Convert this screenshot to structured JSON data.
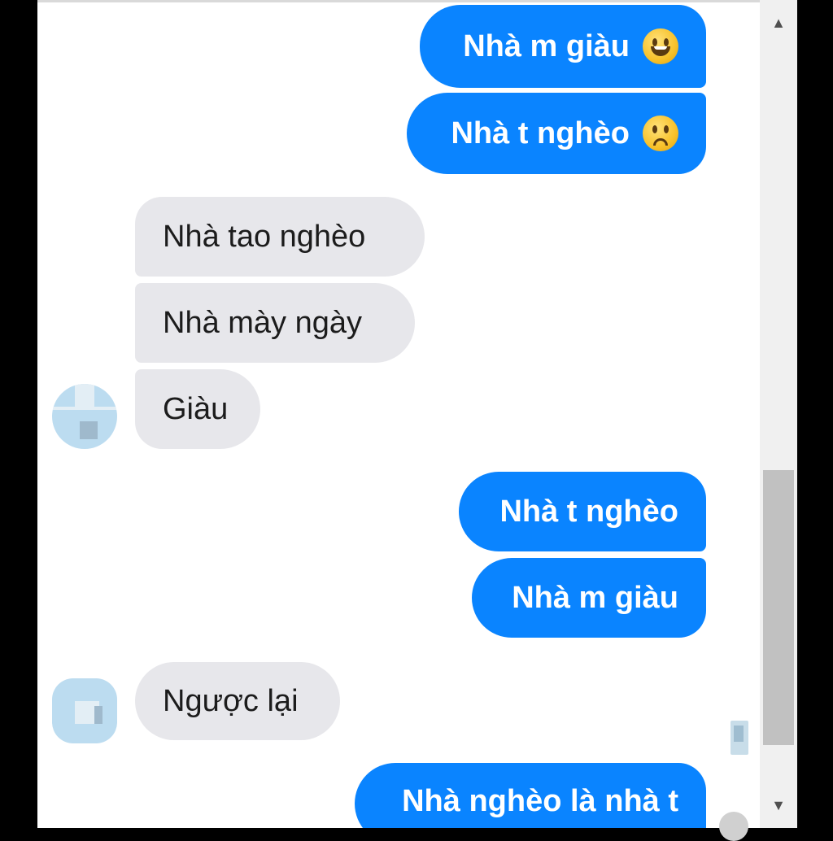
{
  "messages": [
    {
      "label": "Nhà m giàu",
      "emoji": "grinning-face-icon"
    },
    {
      "label": "Nhà t nghèo",
      "emoji": "frowning-face-icon"
    },
    {
      "label": "Nhà tao nghèo"
    },
    {
      "label": "Nhà mày ngày"
    },
    {
      "label": "Giàu"
    },
    {
      "label": "Nhà t nghèo"
    },
    {
      "label": "Nhà m giàu"
    },
    {
      "label": "Ngược lại"
    },
    {
      "label": "Nhà nghèo là nhà t"
    }
  ],
  "colors": {
    "outgoing_bubble": "#0a84ff",
    "incoming_bubble": "#e7e7eb",
    "outgoing_text": "#ffffff",
    "incoming_text": "#1c1c1c"
  },
  "scrollbar": {
    "up_arrow": "▲",
    "down_arrow": "▼"
  }
}
